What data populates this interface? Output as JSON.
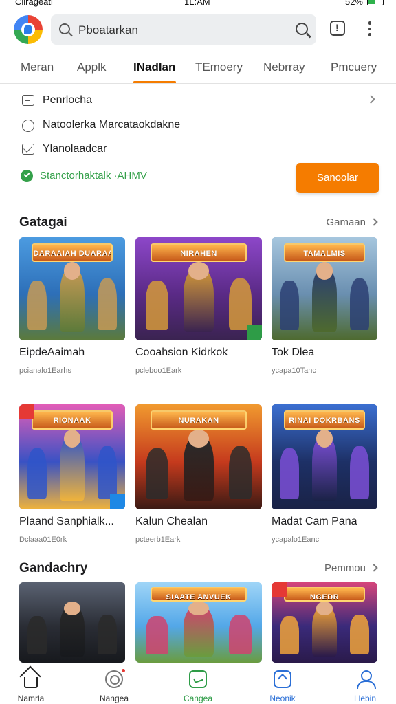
{
  "status_bar": {
    "carrier": "Cllrageati",
    "time": "1L:AM",
    "battery": "52%",
    "battery_level": 0.52
  },
  "header": {
    "search_placeholder": "Pboatarkan"
  },
  "tabs": [
    {
      "label": "Meran"
    },
    {
      "label": "Applk"
    },
    {
      "label": "INadlan",
      "active": true
    },
    {
      "label": "TEmoery"
    },
    {
      "label": "Nebrray"
    },
    {
      "label": "Pmcuery"
    }
  ],
  "menu": {
    "items": [
      {
        "label": "Penrlocha",
        "icon": "folder-icon"
      },
      {
        "label": "Natoolerka Marcataokdakne",
        "icon": "chat-bubble-icon"
      },
      {
        "label": "Ylanolaadcar",
        "icon": "mail-icon"
      }
    ],
    "verified_text": "Stanctorhaktalk ·AHMV",
    "cta_label": "Sanoolar"
  },
  "sections": [
    {
      "title": "Gatagai",
      "more": "Gamaan",
      "cards": [
        {
          "name": "EipdeAaimah",
          "meta": "pcianalo1Earhs"
        },
        {
          "name": "Cooahsion Kidrkok",
          "meta": "pcleboo1Eark"
        },
        {
          "name": "Tok Dlea",
          "meta": "ycapa10Tanc"
        },
        {
          "name": "Plaand Sanphialk...",
          "meta": "Dclaaa01E0rk"
        },
        {
          "name": "Kalun Chealan",
          "meta": "pcteerb1Eark"
        },
        {
          "name": "Madat Cam Pana",
          "meta": "ycapalo1Eanc"
        }
      ]
    },
    {
      "title": "Gandachry",
      "more": "Pemmou",
      "cards": [
        {
          "name": ""
        },
        {
          "name": ""
        },
        {
          "name": ""
        }
      ]
    }
  ],
  "thumb_banners": [
    "DARAAIAH DUARAAN",
    "NIRAHEN",
    "TAMALMIS",
    "RIONAAK",
    "NURAKAN",
    "RINAI DOKRBANS",
    "",
    "SIAATE ANVUEK",
    "NGEDR"
  ],
  "bottom_nav": [
    {
      "label": "Namrla",
      "icon": "home-icon"
    },
    {
      "label": "Nangea",
      "icon": "games-icon"
    },
    {
      "label": "Cangea",
      "icon": "apps-icon"
    },
    {
      "label": "Neonik",
      "icon": "news-icon"
    },
    {
      "label": "Llebin",
      "icon": "profile-icon"
    }
  ],
  "colors": {
    "accent": "#f57c00",
    "green": "#34a04a",
    "blue": "#2b6fd6"
  }
}
